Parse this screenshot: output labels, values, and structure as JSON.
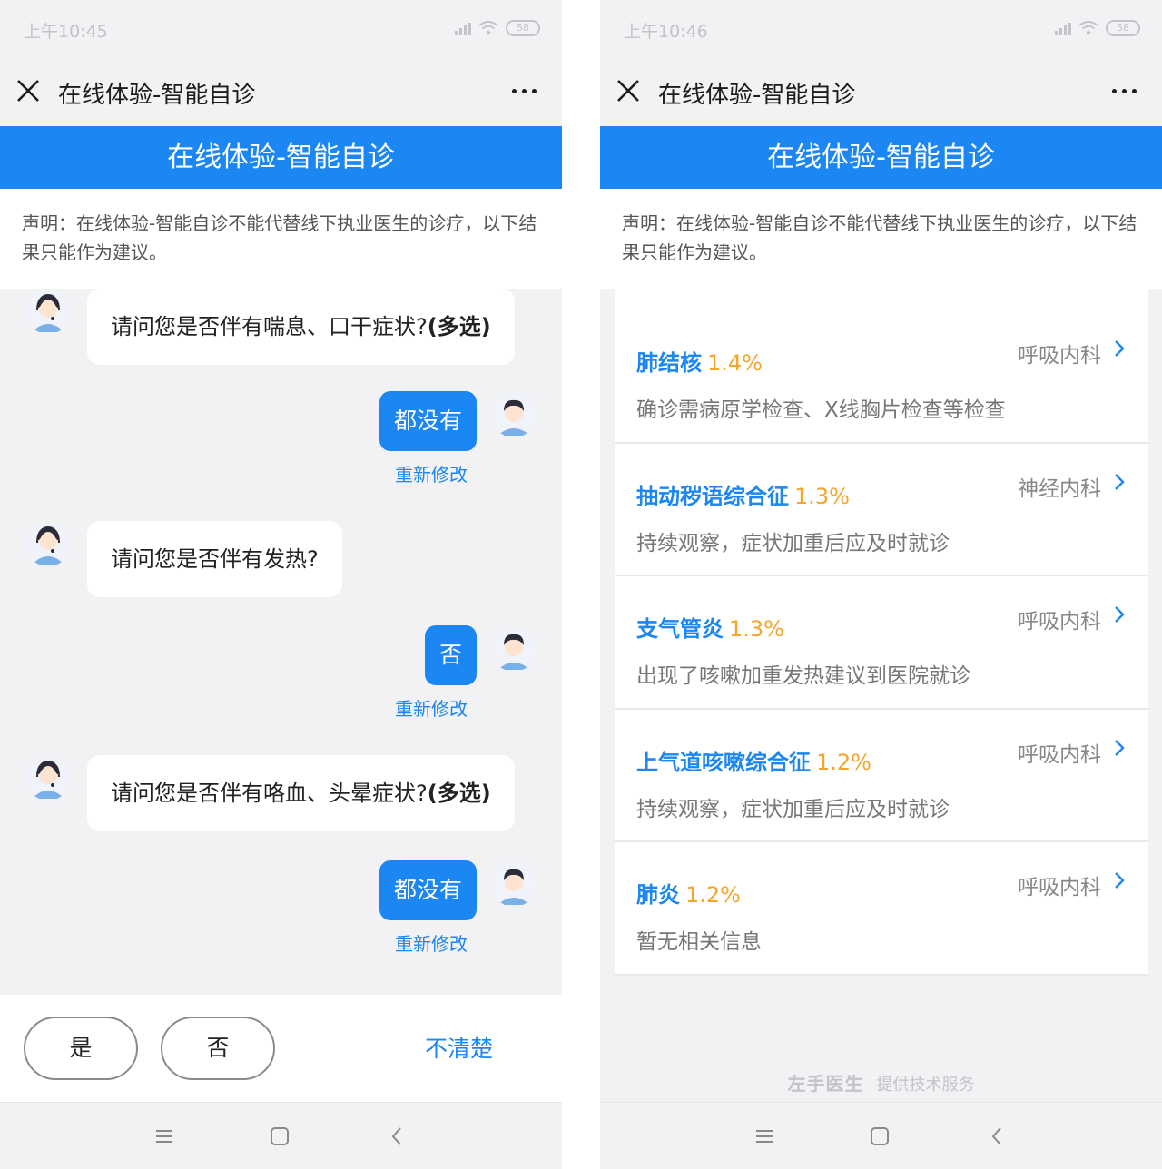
{
  "left": {
    "status": {
      "time": "上午10:45",
      "battery": "58"
    },
    "title": "在线体验-智能自诊",
    "banner": "在线体验-智能自诊",
    "notice": "声明：在线体验-智能自诊不能代替线下执业医生的诊疗，以下结果只能作为建议。",
    "messages": [
      {
        "q": "请问您是否伴有喘息、口干症状?",
        "multi": "(多选)",
        "a": "都没有",
        "edit": "重新修改"
      },
      {
        "q": "请问您是否伴有发热?",
        "multi": "",
        "a": "否",
        "edit": "重新修改"
      },
      {
        "q": "请问您是否伴有咯血、头晕症状?",
        "multi": "(多选)",
        "a": "都没有",
        "edit": "重新修改"
      }
    ],
    "options": {
      "yes": "是",
      "no": "否",
      "unclear": "不清楚"
    }
  },
  "right": {
    "status": {
      "time": "上午10:46",
      "battery": "58"
    },
    "title": "在线体验-智能自诊",
    "banner": "在线体验-智能自诊",
    "notice": "声明：在线体验-智能自诊不能代替线下执业医生的诊疗，以下结果只能作为建议。",
    "results": [
      {
        "name": "肺结核",
        "pct": "1.4%",
        "dept": "呼吸内科",
        "desc": "确诊需病原学检查、X线胸片检查等检查"
      },
      {
        "name": "抽动秽语综合征",
        "pct": "1.3%",
        "dept": "神经内科",
        "desc": "持续观察，症状加重后应及时就诊"
      },
      {
        "name": "支气管炎",
        "pct": "1.3%",
        "dept": "呼吸内科",
        "desc": "出现了咳嗽加重发热建议到医院就诊"
      },
      {
        "name": "上气道咳嗽综合征",
        "pct": "1.2%",
        "dept": "呼吸内科",
        "desc": "持续观察，症状加重后应及时就诊"
      },
      {
        "name": "肺炎",
        "pct": "1.2%",
        "dept": "呼吸内科",
        "desc": "暂无相关信息"
      }
    ],
    "footer": {
      "brand": "左手医生",
      "text": "提供技术服务"
    }
  },
  "colors": {
    "accent": "#1c86f2",
    "percent": "#f4a52a"
  },
  "icons": [
    "close-icon",
    "more-icon",
    "doctor-avatar-icon",
    "user-avatar-icon",
    "chevron-right-icon",
    "menu-icon",
    "home-icon",
    "back-icon"
  ]
}
